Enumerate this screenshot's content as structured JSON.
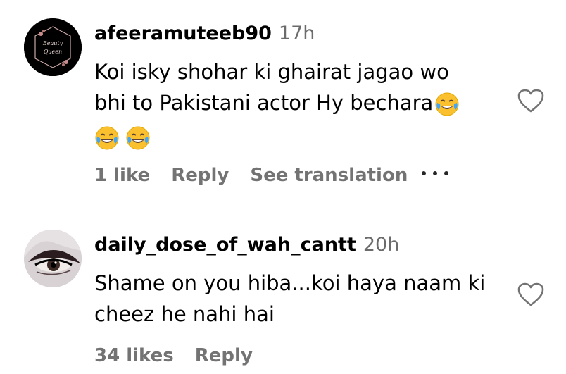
{
  "comments": [
    {
      "username": "afeeramuteeb90",
      "time": "17h",
      "text_line1": "Koi isky shohar ki ghairat jagao wo",
      "text_line2": "bhi to Pakistani actor Hy bechara",
      "emojis": [
        "tears-of-joy",
        "tears-of-joy",
        "tears-of-joy"
      ],
      "likes_label": "1 like",
      "reply_label": "Reply",
      "translation_label": "See translation",
      "more_icon": "more-horizontal-icon",
      "like_icon": "heart-outline-icon"
    },
    {
      "username": "daily_dose_of_wah_cantt",
      "time": "20h",
      "text_line1": "Shame on you hiba...koi haya naam ki",
      "text_line2": "cheez he nahi hai",
      "likes_label": "34 likes",
      "reply_label": "Reply",
      "like_icon": "heart-outline-icon"
    }
  ],
  "colors": {
    "text": "#000000",
    "muted": "#737373",
    "timestamp": "#6b6b6b",
    "emoji_face": "#fbc02d"
  }
}
